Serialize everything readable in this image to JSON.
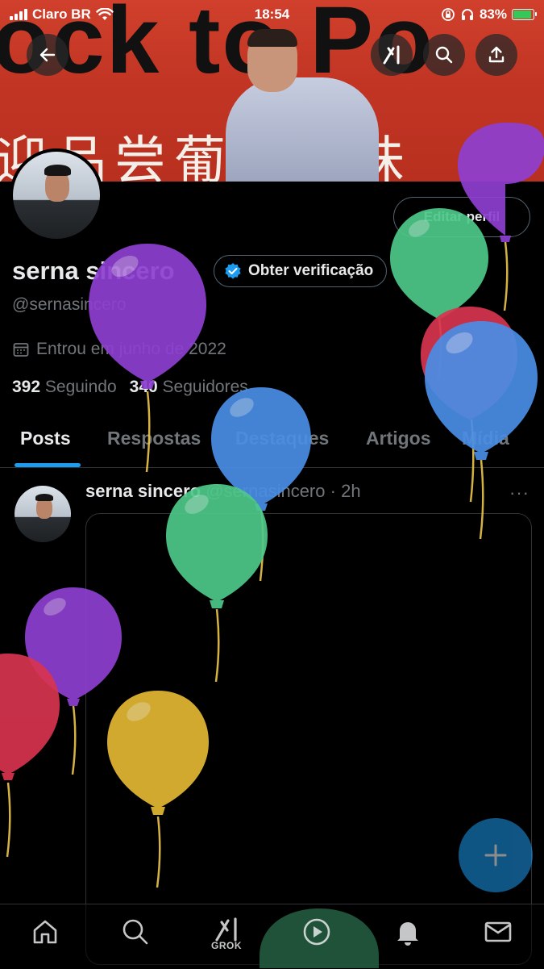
{
  "status_bar": {
    "carrier": "Claro BR",
    "time": "18:54",
    "battery_percent": "83%",
    "battery_level": 0.83
  },
  "header": {
    "back_icon": "arrow-left-icon",
    "grok_icon": "grok-icon",
    "search_icon": "search-icon",
    "share_icon": "share-icon"
  },
  "banner": {
    "big_text": "ock to Po",
    "cjk_text": "迎品尝葡萄风味"
  },
  "profile": {
    "display_name": "serna sincero",
    "handle": "@sernasincero",
    "verify_label": "Obter verificação",
    "edit_label": "Editar perfil",
    "joined": "Entrou em junho de 2022",
    "following_count": "392",
    "following_label": "Seguindo",
    "followers_count": "340",
    "followers_label": "Seguidores"
  },
  "tabs": [
    {
      "label": "Posts",
      "active": true
    },
    {
      "label": "Respostas"
    },
    {
      "label": "Destaques"
    },
    {
      "label": "Artigos"
    },
    {
      "label": "Mídia"
    }
  ],
  "post": {
    "author": "serna sincero",
    "handle": "@sernasincero",
    "separator": "·",
    "time": "2h",
    "more": "···"
  },
  "bottom_nav": [
    {
      "icon": "home-icon"
    },
    {
      "icon": "search-icon"
    },
    {
      "icon": "grok-icon",
      "label": "GROK"
    },
    {
      "icon": "play-icon"
    },
    {
      "icon": "bell-icon"
    },
    {
      "icon": "mail-icon"
    }
  ],
  "fab": {
    "icon": "plus-icon"
  },
  "colors": {
    "accent": "#1d9bf0",
    "background": "#000000",
    "text_primary": "#e7e9ea",
    "text_secondary": "#71767b",
    "border": "#2f3336",
    "banner_red": "#c23524"
  },
  "balloon_colors": {
    "purple": "#8e3fd1",
    "green": "#4ec98a",
    "blue": "#4a8ee6",
    "red": "#d8344f",
    "yellow": "#e2b832"
  }
}
